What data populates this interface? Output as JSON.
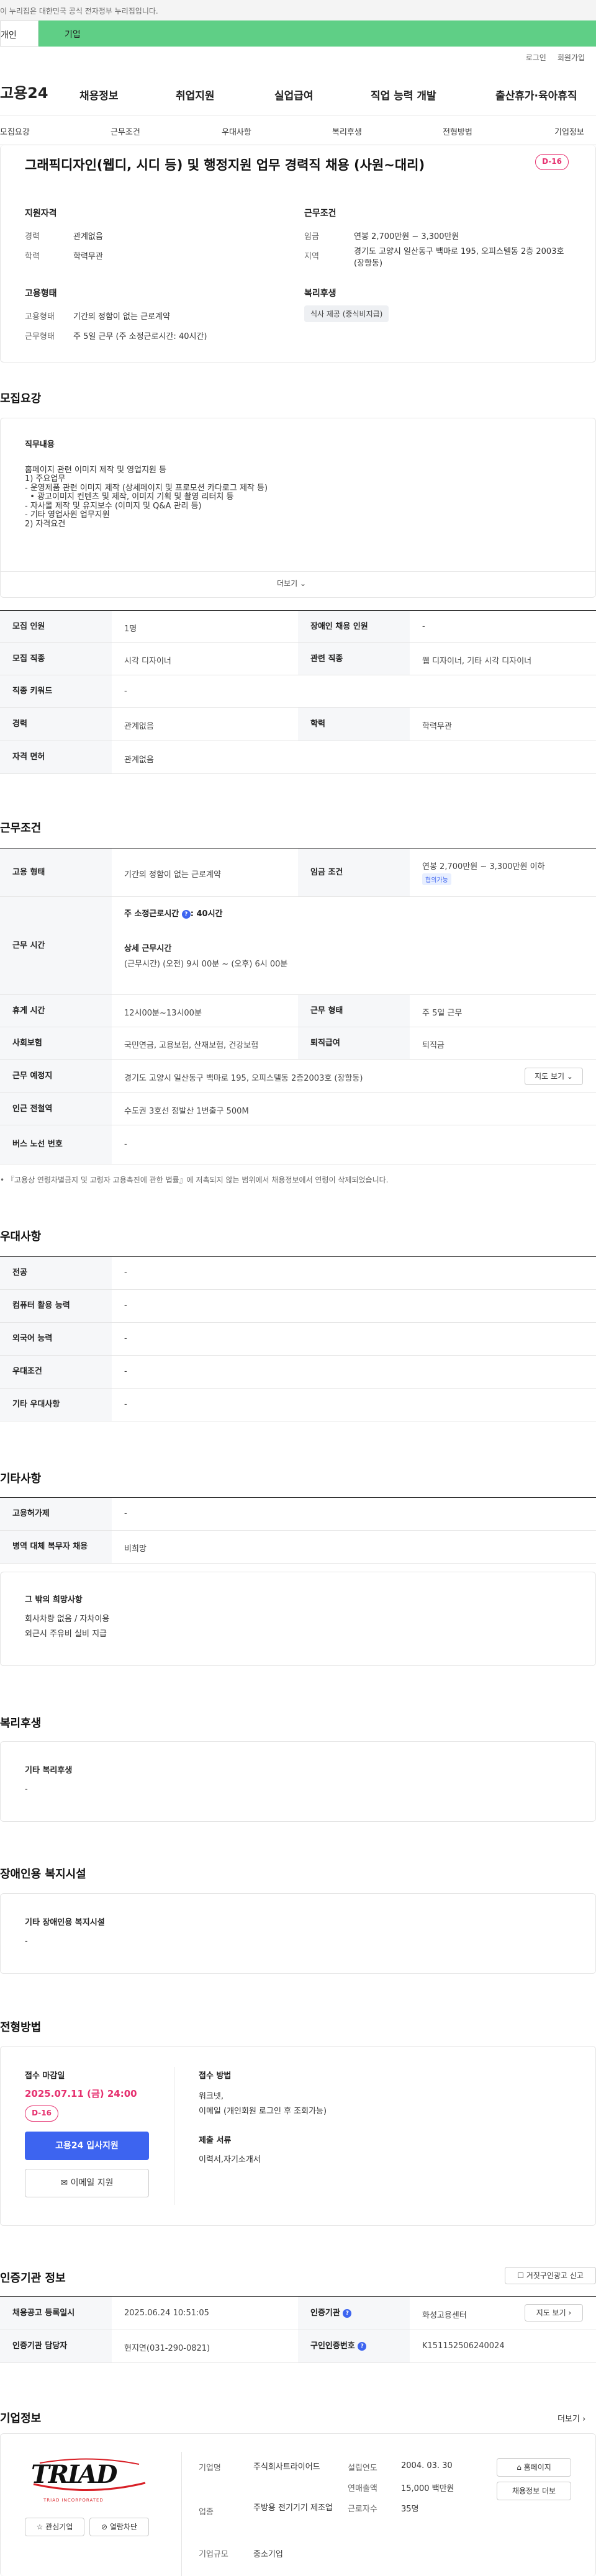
{
  "gov": "이 누리집은 대한민국 공식 전자정부 누리집입니다.",
  "top_tabs": [
    "개인",
    "기업"
  ],
  "util": [
    "로그인",
    "회원가입"
  ],
  "brand": "고용24",
  "gnb": [
    "채용정보",
    "취업지원",
    "실업급여",
    "직업 능력 개발",
    "출산휴가·육아휴직"
  ],
  "anchors": [
    "모집요강",
    "근무조건",
    "우대사항",
    "복리후생",
    "전형방법",
    "기업정보"
  ],
  "job": {
    "title": "그래픽디자인(웹디, 시디 등) 및 행정지원 업무 경력직 채용 (사원~대리)",
    "dday": "D-16"
  },
  "summary": {
    "qual_title": "지원자격",
    "career_lbl": "경력",
    "career_val": "관계없음",
    "edu_lbl": "학력",
    "edu_val": "학력무관",
    "cond_title": "근무조건",
    "wage_lbl": "임금",
    "wage_val": "연봉 2,700만원 ~ 3,300만원",
    "area_lbl": "지역",
    "area_val": "경기도 고양시 일산동구 백마로 195, 오피스텔동 2층 2003호 (장항동)",
    "emp_title": "고용형태",
    "emp_lbl": "고용형태",
    "emp_val": "기간의 정함이 없는 근로계약",
    "work_lbl": "근무형태",
    "work_val": "주 5일 근무 (주 소정근로시간: 40시간)",
    "welfare_title": "복리후생",
    "welfare_pill": "식사 제공 (중식비지급)"
  },
  "recruit": {
    "title": "모집요강",
    "duty_title": "직무내용",
    "lines": [
      "홈페이지 관련 이미지 제작 및 영업지원 등",
      "",
      "1) 주요업무",
      "- 운영제품 관련 이미지 제작 (상세페이지 및 프로모션 카다로그 제작 등)",
      "  • 광고이미지 컨텐츠 및 제작, 이미지 기획 및 촬영 리터치 등",
      "- 자사몰 제작 및 유지보수 (이미지 및 Q&A 관리 등)",
      "- 기타 영업사원 업무지원",
      "",
      "2) 자격요건"
    ],
    "more": "더보기",
    "rows": [
      [
        "모집 인원",
        "1명",
        "장애인 채용 인원",
        "-"
      ],
      [
        "모집 직종",
        "시각 디자이너",
        "관련 직종",
        "웹 디자이너, 기타 시각 디자이너"
      ],
      [
        "직종 키워드",
        "-",
        "",
        ""
      ],
      [
        "경력",
        "관계없음",
        "학력",
        "학력무관"
      ],
      [
        "자격 면허",
        "관계없음",
        "",
        ""
      ]
    ]
  },
  "conditions": {
    "title": "근무조건",
    "emp_lbl": "고용 형태",
    "emp_val": "기간의 정함이 없는 근로계약",
    "wage_lbl": "임금 조건",
    "wage_val": "연봉 2,700만원 ~ 3,300만원 이하",
    "wage_tag": "협의가능",
    "hours_lbl": "근무 시간",
    "hours_weekly": "주 소정근로시간",
    "hours_weekly_val": ": 40시간",
    "hours_detail_title": "상세 근무시간",
    "hours_detail": "(근무시간) (오전) 9시 00분 ~ (오후) 6시 00분",
    "rest_lbl": "휴게 시간",
    "rest_val": "12시00분~13시00분",
    "form_lbl": "근무 형태",
    "form_val": "주 5일 근무",
    "ins_lbl": "사회보험",
    "ins_val": "국민연금, 고용보험, 산재보험, 건강보험",
    "sev_lbl": "퇴직급여",
    "sev_val": "퇴직금",
    "place_lbl": "근무 예정지",
    "place_val": "경기도 고양시 일산동구 백마로 195, 오피스텔동 2층2003호 (장항동)",
    "map_btn": "지도 보기",
    "subway_lbl": "인근 전철역",
    "subway_val": "수도권 3호선 정발산 1번출구 500M",
    "bus_lbl": "버스 노선 번호",
    "bus_val": "-",
    "note": "『고용상 연령차별금지 및 고령자 고용촉진에 관한 법률』에 저촉되지 않는 범위에서 채용정보에서 연령이 삭제되었습니다."
  },
  "pref": {
    "title": "우대사항",
    "rows": [
      [
        "전공",
        "-"
      ],
      [
        "컴퓨터 활용 능력",
        "-"
      ],
      [
        "외국어 능력",
        "-"
      ],
      [
        "우대조건",
        "-"
      ],
      [
        "기타 우대사항",
        "-"
      ]
    ]
  },
  "etc": {
    "title": "기타사항",
    "rows": [
      [
        "고용허가제",
        "-"
      ],
      [
        "병역 대체 복무자 채용",
        "비희망"
      ]
    ],
    "box_title": "그 밖의 희망사항",
    "box_lines": [
      "회사차량 없음 / 자차이용",
      "외근시 주유비 실비 지급"
    ]
  },
  "welfare": {
    "title": "복리후생",
    "box_title": "기타 복리후생",
    "box_val": "-"
  },
  "disab": {
    "title": "장애인용 복지시설",
    "box_title": "기타 장애인용 복지시설",
    "box_val": "-"
  },
  "process": {
    "title": "전형방법",
    "deadline_lbl": "접수 마감일",
    "deadline": "2025.07.11 (금) 24:00",
    "dday": "D-16",
    "apply": "고용24 입사지원",
    "email": "이메일 지원",
    "method_title": "접수 방법",
    "methods": [
      "워크넷,",
      "이메일 (개인회원 로그인 후 조회가능)"
    ],
    "docs_title": "제출 서류",
    "docs": "이력서,자기소개서"
  },
  "cert": {
    "title": "인증기관 정보",
    "report": "거짓구인광고 신고",
    "reg_lbl": "채용공고 등록일시",
    "reg_val": "2025.06.24 10:51:05",
    "org_lbl": "인증기관",
    "org_val": "화성고용센터",
    "map_btn": "지도 보기",
    "mgr_lbl": "인증기관 담당자",
    "mgr_val": "현지연(031-290-0821)",
    "id_lbl": "구인인증번호",
    "id_val": "K151152506240024"
  },
  "company": {
    "title": "기업정보",
    "more": "더보기",
    "logo": "TRIAD",
    "logo_sub": "TRIAD INCORPORATED",
    "fav": "관심기업",
    "block": "열람차단",
    "name_lbl": "기업명",
    "name_val": "주식회사트라이어드",
    "ind_lbl": "업종",
    "ind_val": "주방용 전기기기 제조업",
    "size_lbl": "기업규모",
    "size_val": "중소기업",
    "est_lbl": "설립연도",
    "est_val": "2004. 03. 30",
    "sales_lbl": "연매출액",
    "sales_val": "15,000 백만원",
    "staff_lbl": "근로자수",
    "staff_val": "35명",
    "home": "홈페이지",
    "other": "채용정보 더보"
  }
}
